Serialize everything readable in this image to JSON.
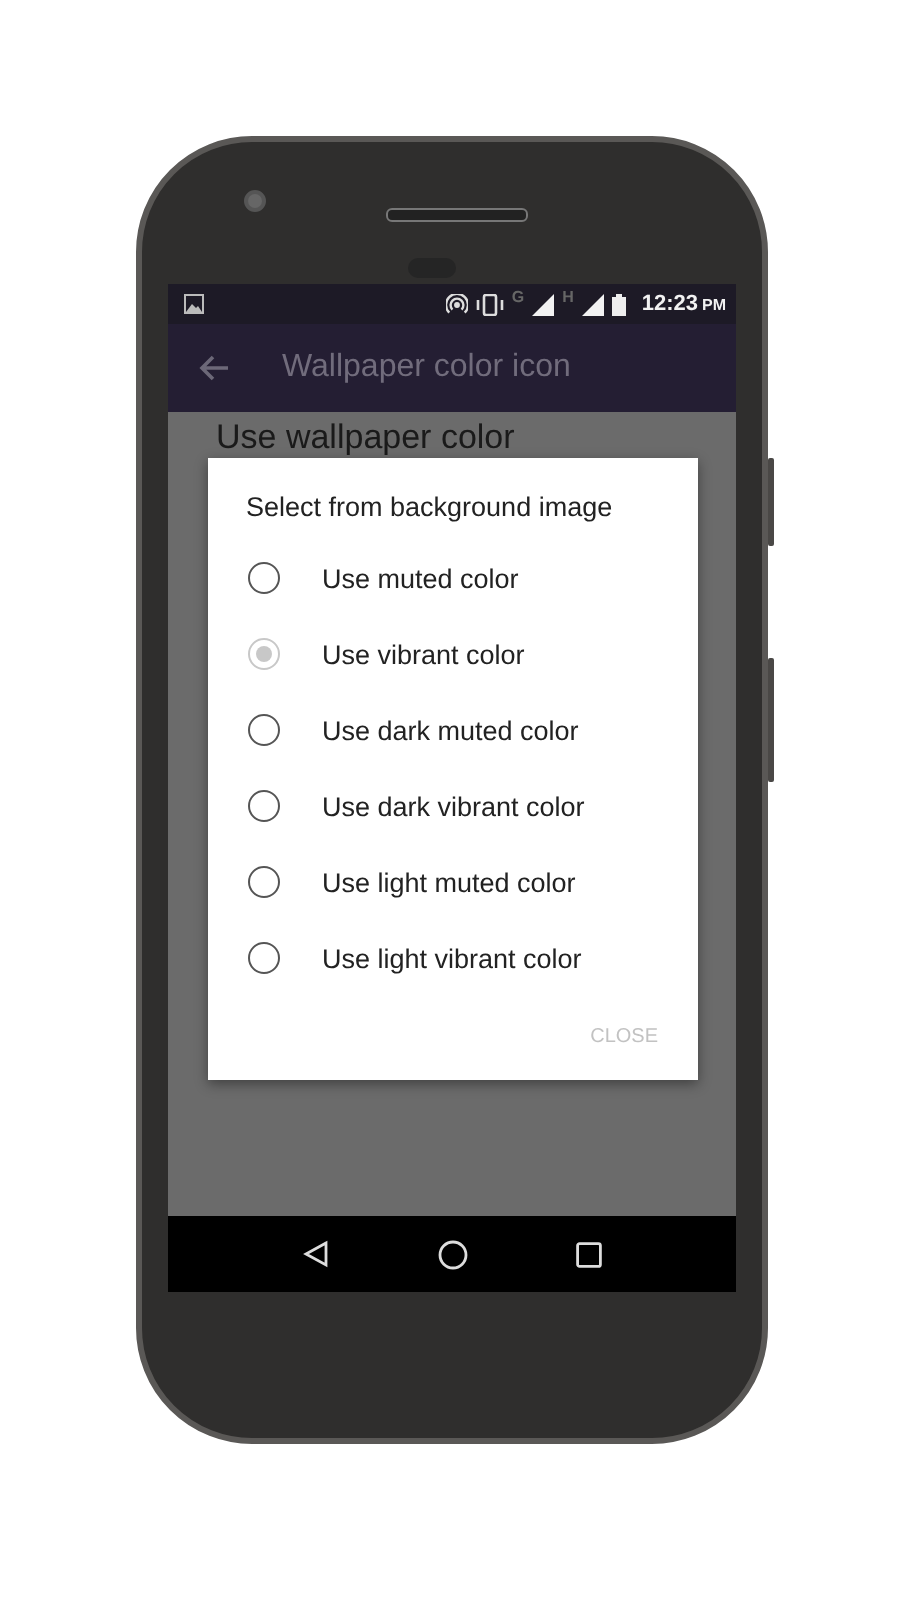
{
  "status_bar": {
    "network_labels": [
      "G",
      "H"
    ],
    "time": "12:23",
    "am_pm": "PM"
  },
  "app_bar": {
    "title": "Wallpaper color icon"
  },
  "content": {
    "title": "Use wallpaper color"
  },
  "dialog": {
    "title": "Select from background image",
    "options": [
      {
        "label": "Use muted color",
        "selected": false
      },
      {
        "label": "Use vibrant color",
        "selected": true
      },
      {
        "label": "Use dark muted color",
        "selected": false
      },
      {
        "label": "Use dark vibrant color",
        "selected": false
      },
      {
        "label": "Use light muted color",
        "selected": false
      },
      {
        "label": "Use light vibrant color",
        "selected": false
      }
    ],
    "close": "CLOSE"
  }
}
